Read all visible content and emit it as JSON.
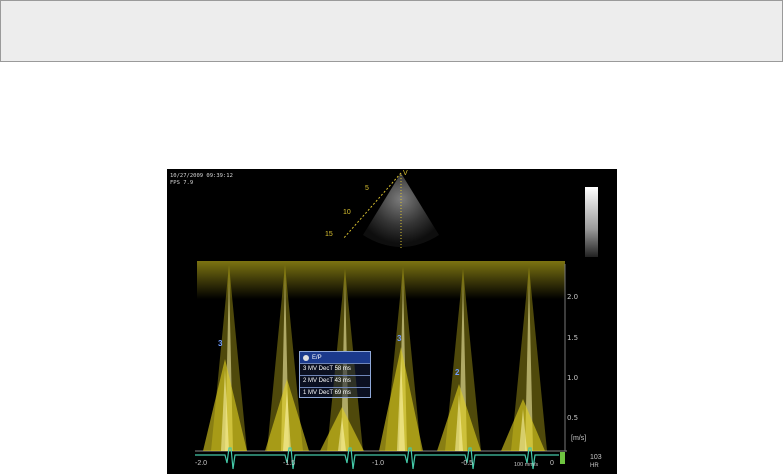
{
  "image": {
    "timestamp": "10/27/2009 09:39:12",
    "fps": "FPS 7.9",
    "velocity_unit": "[m/s]",
    "velocity_ticks": [
      "2.0",
      "1.5",
      "1.0",
      "0.5"
    ],
    "time_ticks": [
      "-2.0",
      "-1.5",
      "-1.0",
      "-0.5",
      "0"
    ],
    "sweep_speed": "100 mm/s",
    "heart_rate": {
      "value": "103",
      "label": "HR"
    },
    "sector_depths": [
      "5",
      "10",
      "15"
    ],
    "sector_marker": "V",
    "measurements": {
      "header": "E/P",
      "rows": [
        "3  MV DecT  58 ms",
        "2  MV DecT  43 ms",
        "1  MV DecT  69 ms"
      ]
    },
    "peak_markers": [
      "3",
      "2",
      "1"
    ],
    "colors": {
      "doppler": "#e2d21f",
      "ecg": "#44c8a8",
      "marker": "#6f9cff",
      "measure_header": "#1b3a8c"
    }
  }
}
